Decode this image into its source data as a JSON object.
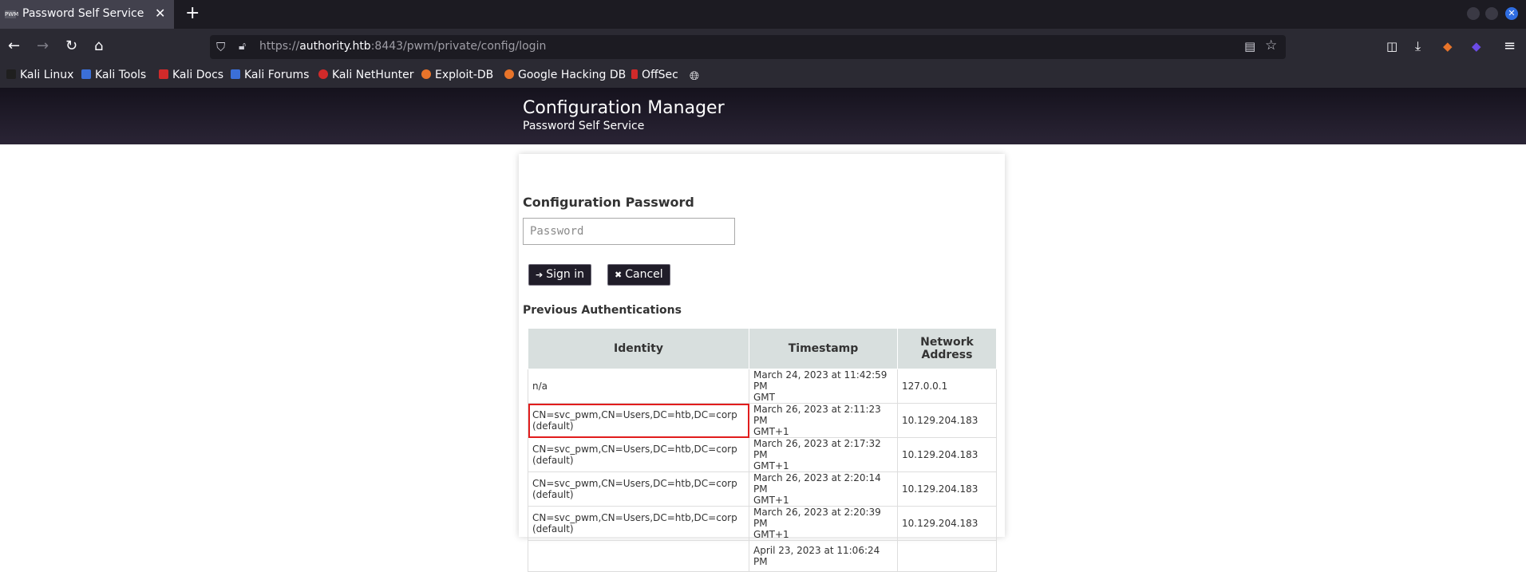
{
  "browser": {
    "tab_title": "Password Self Service",
    "tab_favicon_text": "PWM",
    "url_scheme": "https://",
    "url_host": "authority.htb",
    "url_rest": ":8443/pwm/private/config/login",
    "bookmarks": [
      {
        "label": "Kali Linux",
        "color": "#1f1f1f"
      },
      {
        "label": "Kali Tools",
        "color": "#3b6fd8"
      },
      {
        "label": "Kali Docs",
        "color": "#d12a2a"
      },
      {
        "label": "Kali Forums",
        "color": "#3b6fd8"
      },
      {
        "label": "Kali NetHunter",
        "color": "#d12a2a"
      },
      {
        "label": "Exploit-DB",
        "color": "#e8742a"
      },
      {
        "label": "Google Hacking DB",
        "color": "#e8742a"
      },
      {
        "label": "OffSec",
        "color": "#d12a2a"
      }
    ]
  },
  "header": {
    "title": "Configuration Manager",
    "subtitle": "Password Self Service",
    "bg_color": "#1d1925"
  },
  "login": {
    "label": "Configuration Password",
    "password_placeholder": "Password",
    "sign_in_label": "Sign in",
    "cancel_label": "Cancel"
  },
  "previous": {
    "label": "Previous Authentications",
    "columns": [
      "Identity",
      "Timestamp",
      "Network Address"
    ],
    "rows": [
      {
        "identity": "n/a",
        "identity2": "",
        "time": "March 24, 2023 at 11:42:59 PM",
        "time2": "GMT",
        "address": "127.0.0.1",
        "highlight": false
      },
      {
        "identity": "CN=svc_pwm,CN=Users,DC=htb,DC=corp",
        "identity2": "(default)",
        "time": "March 26, 2023 at 2:11:23 PM",
        "time2": "GMT+1",
        "address": "10.129.204.183",
        "highlight": true
      },
      {
        "identity": "CN=svc_pwm,CN=Users,DC=htb,DC=corp",
        "identity2": "(default)",
        "time": "March 26, 2023 at 2:17:32 PM",
        "time2": "GMT+1",
        "address": "10.129.204.183",
        "highlight": false
      },
      {
        "identity": "CN=svc_pwm,CN=Users,DC=htb,DC=corp",
        "identity2": "(default)",
        "time": "March 26, 2023 at 2:20:14 PM",
        "time2": "GMT+1",
        "address": "10.129.204.183",
        "highlight": false
      },
      {
        "identity": "CN=svc_pwm,CN=Users,DC=htb,DC=corp",
        "identity2": "(default)",
        "time": "March 26, 2023 at 2:20:39 PM",
        "time2": "GMT+1",
        "address": "10.129.204.183",
        "highlight": false
      },
      {
        "identity": "",
        "identity2": "",
        "time": "April 23, 2023 at 11:06:24 PM",
        "time2": "",
        "address": "",
        "highlight": false
      }
    ]
  },
  "colors": {
    "highlight_box": "#e11d1d",
    "table_header_bg": "#d8dfde",
    "button_bg": "#201d29"
  }
}
